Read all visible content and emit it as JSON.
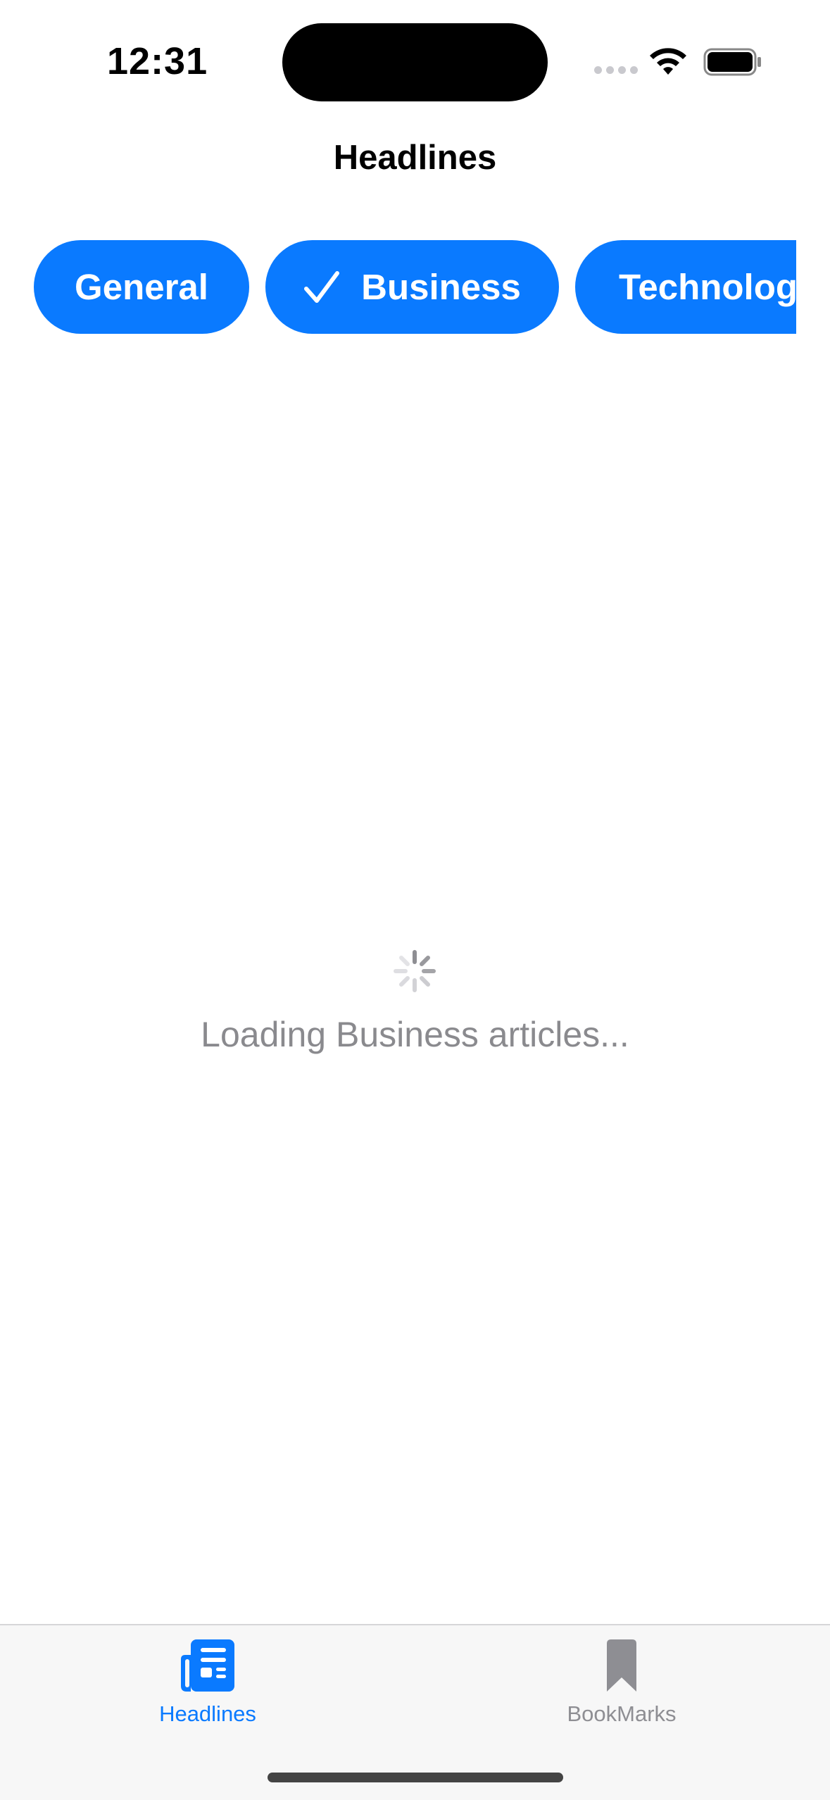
{
  "status_bar": {
    "time": "12:31"
  },
  "nav": {
    "title": "Headlines"
  },
  "categories": [
    {
      "label": "General",
      "selected": false
    },
    {
      "label": "Business",
      "selected": true
    },
    {
      "label": "Technology",
      "selected": false
    }
  ],
  "loading": {
    "message": "Loading Business articles..."
  },
  "tab_bar": {
    "items": [
      {
        "label": "Headlines",
        "icon": "newspaper-icon",
        "active": true
      },
      {
        "label": "BookMarks",
        "icon": "bookmark-icon",
        "active": false
      }
    ]
  },
  "colors": {
    "accent": "#0a7aff",
    "inactive": "#8e8e93",
    "secondary_text": "#8a8a8e"
  }
}
